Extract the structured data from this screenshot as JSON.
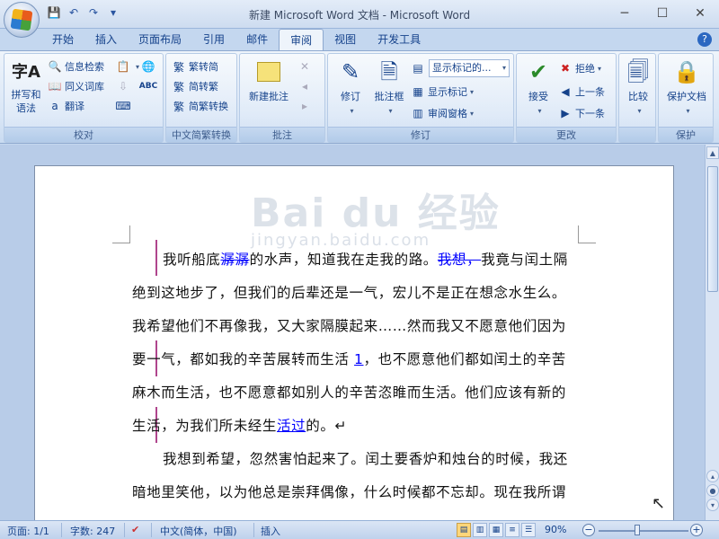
{
  "window": {
    "title": "新建 Microsoft Word 文档 - Microsoft Word",
    "min": "─",
    "max": "☐",
    "close": "✕"
  },
  "qat": {
    "save": "💾",
    "undo": "↶",
    "redo": "↷",
    "more": "▾"
  },
  "tabs": [
    "开始",
    "插入",
    "页面布局",
    "引用",
    "邮件",
    "审阅",
    "视图",
    "开发工具"
  ],
  "active_tab": "审阅",
  "help": "?",
  "ribbon": {
    "proofing": {
      "label": "校对",
      "spell": "拼写和\n语法",
      "spell_line1": "拼写和",
      "spell_line2": "语法",
      "research": "信息检索",
      "thesaurus": "同义词库",
      "translate": "翻译"
    },
    "chinese": {
      "label": "中文简繁转换",
      "to_simplified": "繁转简",
      "to_traditional": "简转繁",
      "convert": "简繁转换"
    },
    "comments": {
      "label": "批注",
      "new_comment": "新建批注"
    },
    "tracking": {
      "label": "修订",
      "track": "修订",
      "balloons": "批注框",
      "display": "显示标记的...",
      "show_markup": "显示标记",
      "reviewing_pane": "审阅窗格"
    },
    "changes": {
      "label": "更改",
      "accept": "接受",
      "reject": "拒绝",
      "previous": "上一条",
      "next": "下一条"
    },
    "compare": {
      "label": "",
      "compare": "比较"
    },
    "protect": {
      "label": "保护",
      "protect_doc": "保护文档"
    }
  },
  "watermark": {
    "brand": "Bai du 经验",
    "url": "jingyan.baidu.com"
  },
  "document": {
    "lines": [
      {
        "parts": [
          [
            "t",
            "我听船底"
          ],
          [
            "del",
            "潺潺"
          ],
          [
            "t",
            "的水声，知道我在走我的路。"
          ],
          [
            "del",
            "我想，"
          ],
          [
            "t",
            "我竟与闰土隔"
          ]
        ]
      },
      {
        "parts": [
          [
            "t",
            "绝到这地步了，但我们的后辈还是一气，宏儿不是正在想念水生么。"
          ]
        ]
      },
      {
        "parts": [
          [
            "t",
            "我希望他们不再像我，又大家隔膜起来……然而我又不愿意他们因为"
          ]
        ]
      },
      {
        "parts": [
          [
            "t",
            "要一气，都如我的辛苦展转而生活 "
          ],
          [
            "ins",
            "1"
          ],
          [
            "t",
            "，也不愿意他们都如闰土的辛苦"
          ]
        ]
      },
      {
        "parts": [
          [
            "t",
            "麻木而生活，也不愿意都如别人的辛苦恣睢而生活。他们应该有新的"
          ]
        ]
      },
      {
        "parts": [
          [
            "t",
            "生活，为我们所未经生"
          ],
          [
            "ins",
            "活过"
          ],
          [
            "t",
            "的。↵"
          ]
        ]
      },
      {
        "parts": [
          [
            "t",
            "我想到希望，忽然害怕起来了。闰土要香炉和烛台的时候，我还"
          ]
        ]
      },
      {
        "parts": [
          [
            "t",
            "暗地里笑他，以为他总是崇拜偶像，什么时候都不忘却。现在我所谓"
          ]
        ]
      }
    ]
  },
  "status": {
    "page": "页面: 1/1",
    "words": "字数: 247",
    "language": "中文(简体，中国)",
    "mode": "插入",
    "zoom": "90%"
  }
}
